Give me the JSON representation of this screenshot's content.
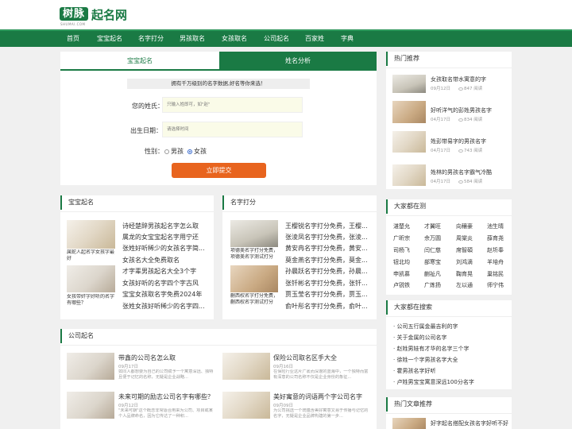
{
  "header": {
    "logo_main": "树脉",
    "logo_sub": "SHUMAI.COM",
    "logo_text": "起名网"
  },
  "nav": [
    "首页",
    "宝宝起名",
    "名字打分",
    "男孩取名",
    "女孩取名",
    "公司起名",
    "百家姓",
    "字典"
  ],
  "form": {
    "tab_active": "宝宝起名",
    "tab_inactive": "姓名分析",
    "banner": "拥有千万级别的名字数据,好名等你来选！",
    "surname_label": "您的姓氏：",
    "surname_placeholder": "只输入姓即可，如\"赵\"",
    "birth_label": "出生日期：",
    "birth_placeholder": "请选择时间",
    "gender_label": "性别：",
    "gender_male": "男孩",
    "gender_female": "女孩",
    "gender_selected": "女孩",
    "submit": "立即提交"
  },
  "baby": {
    "title": "宝宝起名",
    "thumb_caption": "属蛇人起名字女孩字最好",
    "thumb_caption2": "女孩带奸字好听的名字有哪些？",
    "items": [
      "诗经楚辞男孩起名字怎么取",
      "属龙的女宝宝起名字用宁还",
      "张姓好听稀少的女孩名字简...",
      "女孩名大全免费取名",
      "才字辈男孩起名大全3个字",
      "女孩好听的名字四个字古风",
      "宝宝女孩取名字免费2024年",
      "张姓女孩好听稀少的名字四..."
    ]
  },
  "score": {
    "title": "名字打分",
    "thumb_caption": "项德美名字打分免费，项德美名字测试打分",
    "thumb_caption2": "蒯西权名字打分免费，蒯西权名字测试打分",
    "items": [
      "王樱锐名字打分免费，王樱...",
      "张淩凤名字打分免费，张淩...",
      "黄安冉名字打分免费，黄安...",
      "莫金燕名字打分免费，莫金...",
      "孙晨跃名字打分免费，孙晨...",
      "张钎彬名字打分免费，张钎...",
      "贾玉莹名字打分免费，贾玉...",
      "俞叶彤名字打分免费，俞叶..."
    ]
  },
  "company": {
    "title": "公司起名",
    "items": [
      {
        "title": "带鑫的公司名怎么取",
        "date": "09月17日",
        "desc": "如同人都想要为自己的公司赋予一个寓意深远、独特且便于记忆的名称，无疑是企业战略..."
      },
      {
        "title": "保险公司取名区手大全",
        "date": "09月16日",
        "desc": "在保险行业这片广袤而深邃的蓝海中，一个独特而富有深意的公司名称不仅是企业身份的象征..."
      },
      {
        "title": "未来可期的励志公司名字有哪些？",
        "date": "09月12日",
        "desc": "\"未来可期\"这个概念非常适合用来为公司、项目或某个人品牌命名，因为它传达了一种积..."
      },
      {
        "title": "美好寓意的词语两个字公司名字",
        "date": "09月09日",
        "desc": "为公司挑选一个既蕴含美好寓意又易于传播与记忆的名字，无疑是企业品牌构建的第一步..."
      }
    ]
  },
  "hot": {
    "title": "热门推荐",
    "items": [
      {
        "title": "女孩取名带水寓意的字",
        "date": "09月12日",
        "views": "847 阅读"
      },
      {
        "title": "好听洋气的彭姓男孩名字",
        "date": "04月17日",
        "views": "834 阅读"
      },
      {
        "title": "姓彭带易字的男孩名字",
        "date": "04月17日",
        "views": "743 阅读"
      },
      {
        "title": "姓林的男孩名字霸气冷酷",
        "date": "04月17日",
        "views": "584 阅读"
      }
    ]
  },
  "testing": {
    "title": "大家都在测",
    "names": [
      "湛楚允",
      "才翼旺",
      "向穰豪",
      "池生晴",
      "广昕宗",
      "佘万圆",
      "周棠炎",
      "薛育尧",
      "司杨飞",
      "闫仁慈",
      "席智碩",
      "赵圻奉",
      "钮北均",
      "部寒宝",
      "刘鸿滴",
      "羊培舟",
      "申凯慕",
      "蒯祉凡",
      "鞠育晃",
      "巢铭民",
      "卢锐铁",
      "广炼扬",
      "左以通",
      "师宁伟"
    ]
  },
  "searching": {
    "title": "大家都在搜索",
    "items": [
      "公司五行属金最吉利的字",
      "关于金属的公司名字",
      "赵姓男娃有才华的名字三个字",
      "徐姓一个字男孩名字大全",
      "霍男孩名字好听",
      "卢姓男宝宝寓意深远100分名字"
    ]
  },
  "articles": {
    "title": "热门文章推荐",
    "first": "好字起名搭配女孩名字好听不好"
  }
}
